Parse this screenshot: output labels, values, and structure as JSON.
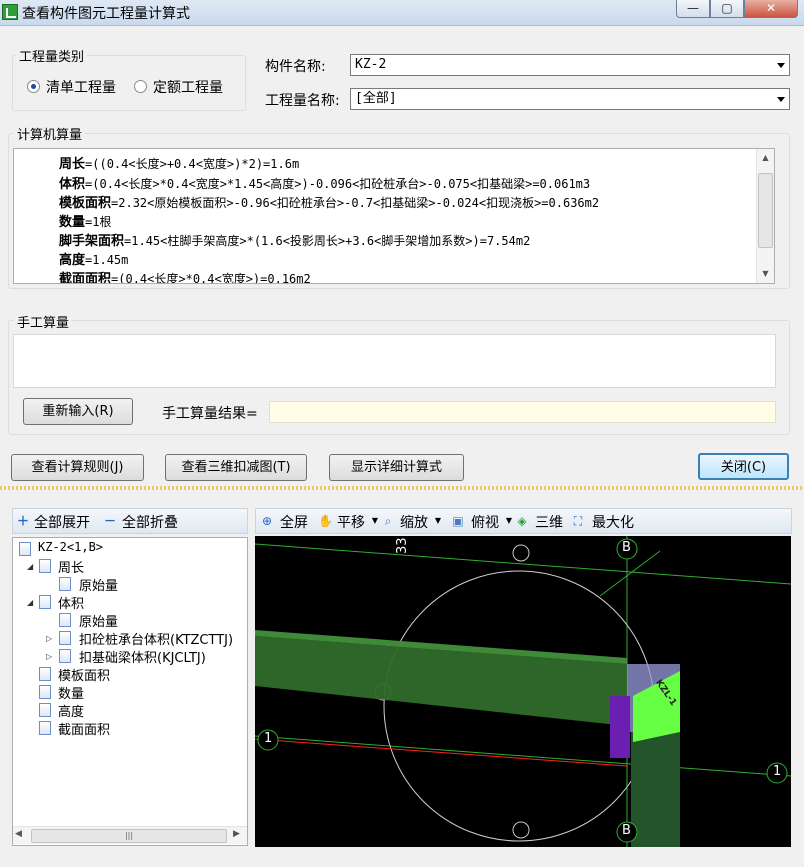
{
  "window": {
    "title": "查看构件图元工程量计算式",
    "min_glyph": "—",
    "max_glyph": "▢",
    "close_glyph": "✕"
  },
  "qty_type": {
    "label": "工程量类别",
    "option1": "清单工程量",
    "option2": "定额工程量",
    "selected": "清单工程量"
  },
  "component_name": {
    "label": "构件名称:",
    "value": "KZ-2"
  },
  "qty_name": {
    "label": "工程量名称:",
    "value": "[全部]"
  },
  "computer_calc": {
    "label": "计算机算量",
    "lines": [
      {
        "name": "周长",
        "expr": "=((0.4<长度>+0.4<宽度>)*2)=1.6m"
      },
      {
        "name": "体积",
        "expr": "=(0.4<长度>*0.4<宽度>*1.45<高度>)-0.096<扣砼桩承台>-0.075<扣基础梁>=0.061m3"
      },
      {
        "name": "模板面积",
        "expr": "=2.32<原始模板面积>-0.96<扣砼桩承台>-0.7<扣基础梁>-0.024<扣现浇板>=0.636m2"
      },
      {
        "name": "数量",
        "expr": "=1根"
      },
      {
        "name": "脚手架面积",
        "expr": "=1.45<柱脚手架高度>*(1.6<投影周长>+3.6<脚手架增加系数>)=7.54m2"
      },
      {
        "name": "高度",
        "expr": "=1.45m"
      },
      {
        "name": "截面面积",
        "expr": "=(0.4<长度>*0.4<宽度>)=0.16m2"
      }
    ]
  },
  "manual_calc": {
    "label": "手工算量",
    "reenter_button": "重新输入(R)",
    "result_label": "手工算量结果="
  },
  "buttons": {
    "view_rules": "查看计算规则(J)",
    "view_3d": "查看三维扣减图(T)",
    "show_detail": "显示详细计算式",
    "close": "关闭(C)"
  },
  "tree_toolbar": {
    "expand_all": "全部展开",
    "collapse_all": "全部折叠"
  },
  "view_toolbar": {
    "fullscreen": "全屏",
    "pan": "平移",
    "zoom": "缩放",
    "top_view": "俯视",
    "three_d": "三维",
    "maximize": "最大化"
  },
  "tree": {
    "root": "KZ-2<1,B>",
    "perimeter": "周长",
    "perimeter_original": "原始量",
    "volume": "体积",
    "volume_original": "原始量",
    "deduct_cap": "扣砼桩承台体积(KTZCTTJ)",
    "deduct_beam": "扣基础梁体积(KJCLTJ)",
    "formwork": "模板面积",
    "quantity": "数量",
    "height": "高度",
    "section": "截面面积"
  },
  "scene": {
    "axis_1_left": "1",
    "axis_1_right": "1",
    "axis_b_top": "B",
    "axis_b_bottom": "B",
    "top_label": "33",
    "column_label": "KZL-1"
  },
  "colors": {
    "accent": "#3c7fb1",
    "beam_green": "#2f6b2a",
    "column_green": "#66ff44",
    "purple": "#6a1fb0",
    "axis_red": "#ff2020",
    "axis_green": "#2fae2f"
  }
}
